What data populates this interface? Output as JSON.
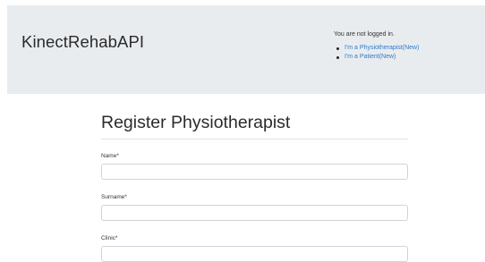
{
  "header": {
    "brand": "KinectRehabAPI",
    "auth_status": "You are not logged in.",
    "links": [
      {
        "label": "I'm a Physiotherapist(New)"
      },
      {
        "label": "I'm a Patient(New)"
      }
    ]
  },
  "form": {
    "title": "Register Physiotherapist",
    "fields": [
      {
        "label": "Name*",
        "value": ""
      },
      {
        "label": "Surname*",
        "value": ""
      },
      {
        "label": "Clinic*",
        "value": ""
      }
    ]
  }
}
